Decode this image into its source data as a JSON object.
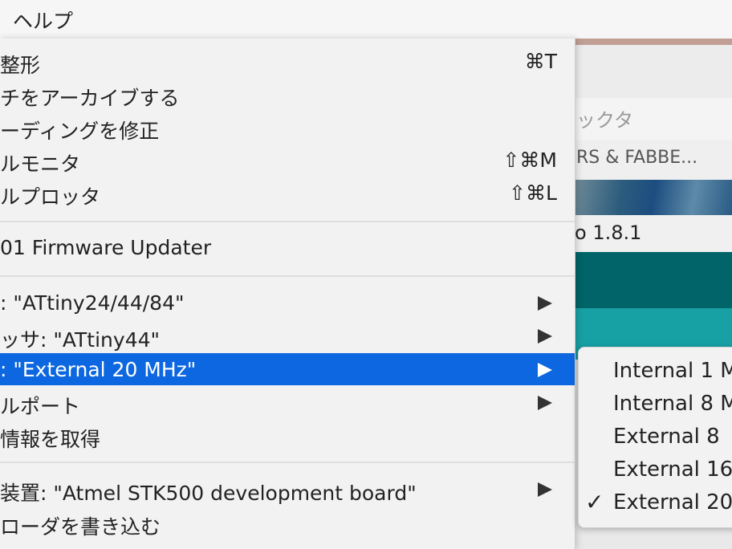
{
  "menubar": {
    "item": "ヘルプ"
  },
  "background": {
    "search_placeholder": "ックタ",
    "tab_text": "RS & FABBE...",
    "version": "o 1.8.1"
  },
  "menu": {
    "items": [
      {
        "label": "整形",
        "shortcut": "⌘T"
      },
      {
        "label": "チをアーカイブする",
        "shortcut": ""
      },
      {
        "label": "ーディングを修正",
        "shortcut": ""
      },
      {
        "label": "ルモニタ",
        "shortcut": "⇧⌘M"
      },
      {
        "label": "ルプロッタ",
        "shortcut": "⇧⌘L"
      },
      {
        "label": "01 Firmware Updater",
        "shortcut": ""
      },
      {
        "label": ": \"ATtiny24/44/84\"",
        "submenu": true
      },
      {
        "label": "ッサ: \"ATtiny44\"",
        "submenu": true
      },
      {
        "label": ": \"External 20 MHz\"",
        "submenu": true,
        "selected": true
      },
      {
        "label": "ルポート",
        "submenu": true
      },
      {
        "label": "情報を取得",
        "shortcut": ""
      },
      {
        "label": "装置: \"Atmel STK500 development board\"",
        "submenu": true
      },
      {
        "label": "ローダを書き込む",
        "shortcut": ""
      }
    ]
  },
  "submenu": {
    "items": [
      {
        "label": "Internal 1 M",
        "checked": false
      },
      {
        "label": "Internal 8 M",
        "checked": false
      },
      {
        "label": "External 8 ",
        "checked": false
      },
      {
        "label": "External 16",
        "checked": false
      },
      {
        "label": "External 20",
        "checked": true
      }
    ],
    "check_mark": "✓"
  },
  "colors": {
    "selection": "#0c67e0",
    "teal_dark": "#006468",
    "teal_light": "#17a1a5"
  }
}
